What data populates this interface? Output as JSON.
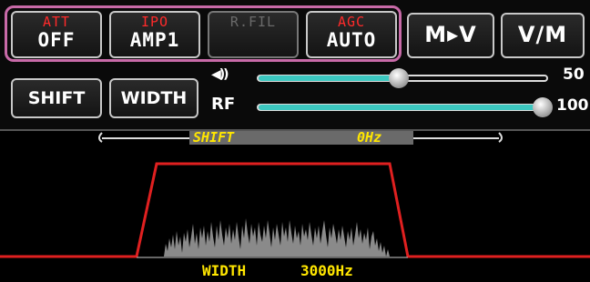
{
  "buttons": {
    "att": {
      "top": "ATT",
      "bottom": "OFF"
    },
    "ipo": {
      "top": "IPO",
      "bottom": "AMP1"
    },
    "rfil": {
      "top": "R.FIL",
      "bottom": ""
    },
    "agc": {
      "top": "AGC",
      "bottom": "AUTO"
    },
    "mv": {
      "label": "M▸V"
    },
    "vm": {
      "label": "V/M"
    },
    "shift": {
      "label": "SHIFT"
    },
    "width": {
      "label": "WIDTH"
    }
  },
  "volume": {
    "label": "◀))",
    "value": "50",
    "level_percent": 50
  },
  "rf": {
    "label": "RF",
    "value": "100",
    "level_percent": 100
  },
  "scope": {
    "shift_label": "SHIFT",
    "shift_value": "0Hz",
    "width_label": "WIDTH",
    "width_value": "3000Hz"
  },
  "colors": {
    "red_label": "#ff2a2a",
    "slider_fill": "#3cc8c0",
    "passband": "#e02020",
    "scope_text": "#ffe600",
    "selection_border": "#c86aa8"
  }
}
